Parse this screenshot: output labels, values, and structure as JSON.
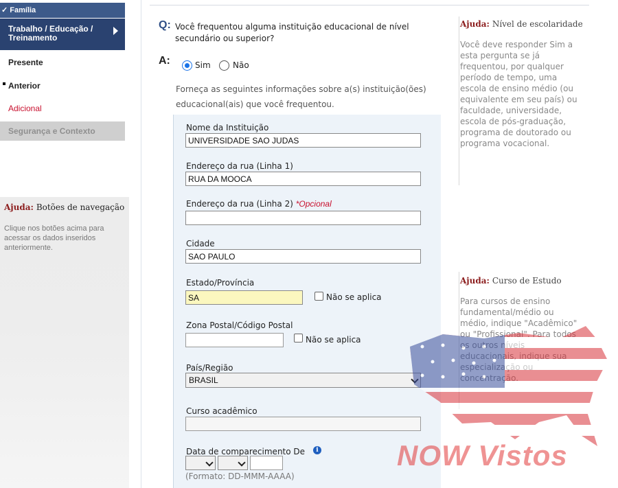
{
  "sidebar": {
    "family": "✓ Família",
    "current_line1": "Trabalho / Educação /",
    "current_line2": "Treinamento",
    "present": "Presente",
    "previous": "Anterior",
    "additional": "Adicional",
    "security": "Segurança e Contexto",
    "help_title_bold": "Ajuda:",
    "help_title": "Botões de navegação",
    "help_text": "Clique nos botões acima para acessar os dados inseridos anteriormente."
  },
  "question": {
    "q": "Q:",
    "text": "Você frequentou alguma instituição educacional de nível secundário ou superior?",
    "a": "A:",
    "yes": "Sim",
    "no": "Não",
    "selected": "Sim",
    "intro": "Forneça as seguintes informações sobre a(s) instituição(ões) educacional(ais) que você frequentou."
  },
  "form": {
    "institution_label": "Nome da Instituição",
    "institution_value": "UNIVERSIDADE SAO JUDAS",
    "street1_label": "Endereço da rua (Linha 1)",
    "street1_value": "RUA DA MOOCA",
    "street2_label": "Endereço da rua (Linha 2)",
    "optional": "*Opcional",
    "street2_value": "",
    "city_label": "Cidade",
    "city_value": "SAO PAULO",
    "state_label": "Estado/Província",
    "state_value": "SA",
    "not_applicable": "Não se aplica",
    "zip_label": "Zona Postal/Código Postal",
    "zip_value": "",
    "country_label": "País/Região",
    "country_value": "BRASIL",
    "course_label": "Curso acadêmico",
    "course_value": "",
    "date_label": "Data de comparecimento De",
    "date_format": "(Formato: DD-MMM-AAAA)"
  },
  "help_right": [
    {
      "title_bold": "Ajuda:",
      "title": "Nível de escolaridade",
      "text": "Você deve responder Sim a esta pergunta se já frequentou, por qualquer período de tempo, uma escola de ensino médio (ou equivalente em seu país) ou faculdade, universidade, escola de pós-graduação, programa de doutorado ou programa vocacional."
    },
    {
      "title_bold": "Ajuda:",
      "title": "Curso de Estudo",
      "text": "Para cursos de ensino fundamental/médio ou médio, indique \"Acadêmico\" ou \"Profissional\". Para todos os outros níveis educacionais, indique sua especialização ou concentração."
    }
  ],
  "watermark": {
    "text": "NOW Vistos"
  },
  "colors": {
    "nav_blue": "#2a4270",
    "accent_red": "#c8102e",
    "help_title_red": "#8c1d1d"
  }
}
